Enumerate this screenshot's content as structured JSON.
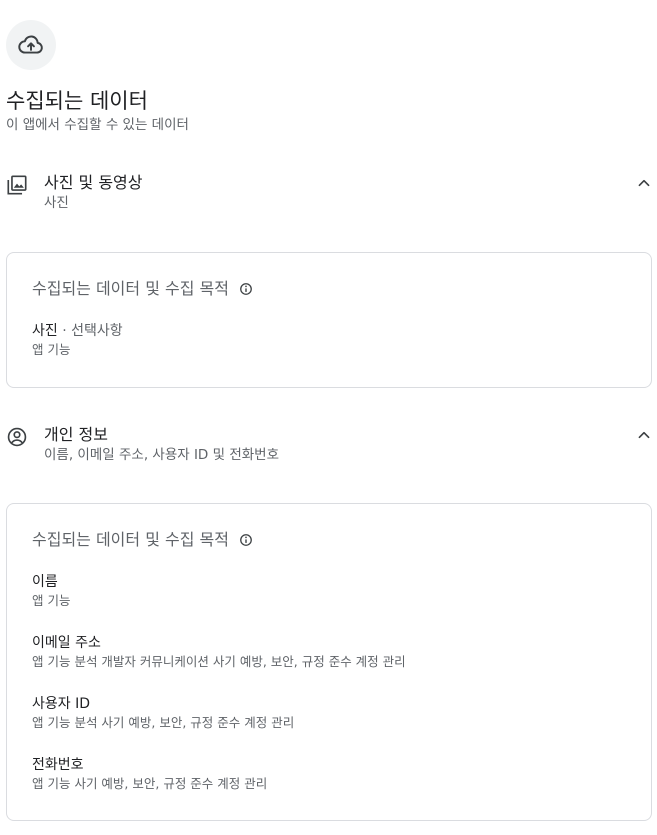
{
  "header": {
    "icon": "cloud-upload-icon",
    "title": "수집되는 데이터",
    "subtitle": "이 앱에서 수집할 수 있는 데이터"
  },
  "sections": [
    {
      "icon": "photo-library-icon",
      "title": "사진 및 동영상",
      "summary": "사진",
      "expanded": true,
      "card": {
        "title": "수집되는 데이터 및 수집 목적",
        "items": [
          {
            "name": "사진",
            "optional": " · 선택사항",
            "purpose": "앱 기능"
          }
        ]
      }
    },
    {
      "icon": "account-circle-icon",
      "title": "개인 정보",
      "summary": "이름, 이메일 주소, 사용자 ID 및 전화번호",
      "expanded": true,
      "card": {
        "title": "수집되는 데이터 및 수집 목적",
        "items": [
          {
            "name": "이름",
            "purpose": "앱 기능"
          },
          {
            "name": "이메일 주소",
            "purpose": "앱 기능 분석 개발자 커뮤니케이션 사기 예방, 보안, 규정 준수 계정 관리"
          },
          {
            "name": "사용자 ID",
            "purpose": "앱 기능 분석 사기 예방, 보안, 규정 준수 계정 관리"
          },
          {
            "name": "전화번호",
            "purpose": "앱 기능 사기 예방, 보안, 규정 준수 계정 관리"
          }
        ]
      }
    }
  ],
  "colors": {
    "text_primary": "#202124",
    "text_secondary": "#5f6368",
    "border": "#dadce0",
    "icon_bg": "#f1f3f4"
  }
}
